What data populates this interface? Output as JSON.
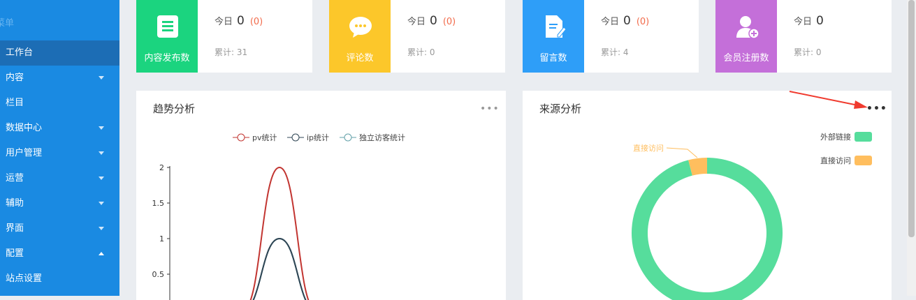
{
  "sidebar": {
    "title": "菜单",
    "items": [
      {
        "label": "工作台",
        "active": true,
        "arrow": ""
      },
      {
        "label": "内容",
        "arrow": "down"
      },
      {
        "label": "栏目",
        "arrow": ""
      },
      {
        "label": "数据中心",
        "arrow": "down"
      },
      {
        "label": "用户管理",
        "arrow": "down"
      },
      {
        "label": "运营",
        "arrow": "down"
      },
      {
        "label": "辅助",
        "arrow": "down"
      },
      {
        "label": "界面",
        "arrow": "down"
      },
      {
        "label": "配置",
        "arrow": "up"
      },
      {
        "label": "站点设置",
        "arrow": ""
      }
    ]
  },
  "cards": [
    {
      "label": "内容发布数",
      "icon": "document-icon",
      "color": "#1bd47f",
      "today_label": "今日",
      "today": "0",
      "delta": "(0)",
      "total": "累计: 31"
    },
    {
      "label": "评论数",
      "icon": "comment-icon",
      "color": "#fcc72a",
      "today_label": "今日",
      "today": "0",
      "delta": "(0)",
      "total": "累计: 0"
    },
    {
      "label": "留言数",
      "icon": "message-edit-icon",
      "color": "#2e9ef8",
      "today_label": "今日",
      "today": "0",
      "delta": "(0)",
      "total": "累计: 4"
    },
    {
      "label": "会员注册数",
      "icon": "user-add-icon",
      "color": "#c46fd9",
      "today_label": "今日",
      "today": "0",
      "delta": "",
      "total": "累计: 0"
    }
  ],
  "trend": {
    "title": "趋势分析",
    "more": "•••"
  },
  "source": {
    "title": "来源分析",
    "more": "•••"
  },
  "chart_data": [
    {
      "type": "line",
      "title": "趋势分析",
      "legend": [
        "pv统计",
        "ip统计",
        "独立访客统计"
      ],
      "legend_position": "top",
      "yticks": [
        "2",
        "1.5",
        "1",
        "0.5"
      ],
      "ylim": [
        0,
        2
      ],
      "series": [
        {
          "name": "pv统计",
          "color": "#c23531",
          "values": [
            0,
            0,
            0,
            2,
            0,
            0,
            0,
            0,
            0
          ]
        },
        {
          "name": "ip统计",
          "color": "#2f4554",
          "values": [
            0,
            0,
            0,
            1,
            0,
            0,
            0,
            0,
            0
          ]
        },
        {
          "name": "独立访客统计",
          "color": "#61a0a8",
          "values": [
            0,
            0,
            0,
            1,
            0,
            0,
            0,
            0,
            0
          ]
        }
      ]
    },
    {
      "type": "pie",
      "title": "来源分析",
      "legend_position": "top-right",
      "slices": [
        {
          "name": "外部链接",
          "value": 96,
          "color": "#56dd9c"
        },
        {
          "name": "直接访问",
          "value": 4,
          "color": "#ffbe5e"
        }
      ],
      "label": "直接访问"
    }
  ]
}
